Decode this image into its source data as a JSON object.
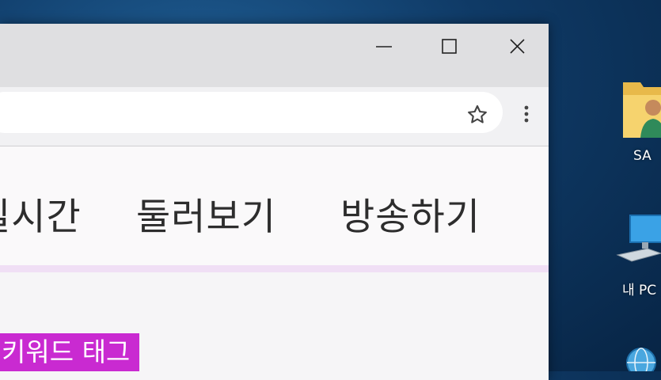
{
  "window": {
    "controls": {
      "minimize": "minimize-icon",
      "maximize": "maximize-icon",
      "close": "close-icon"
    }
  },
  "toolbar": {
    "bookmark_icon": "star-icon",
    "menu_icon": "kebab-menu-icon"
  },
  "nav": {
    "live_label": "실시간",
    "browse_label": "둘러보기",
    "broadcast_label": "방송하기"
  },
  "keyword_tag": "키워드 태그",
  "desktop": {
    "icons": [
      {
        "label": "SA",
        "icon": "user-folder-icon"
      },
      {
        "label": "내 PC",
        "icon": "computer-icon"
      },
      {
        "label": "",
        "icon": "network-icon"
      }
    ]
  },
  "colors": {
    "desktop_bg": "#0f3a66",
    "accent_stripe": "#f0dff5",
    "tag_bg": "#c92ad1"
  }
}
